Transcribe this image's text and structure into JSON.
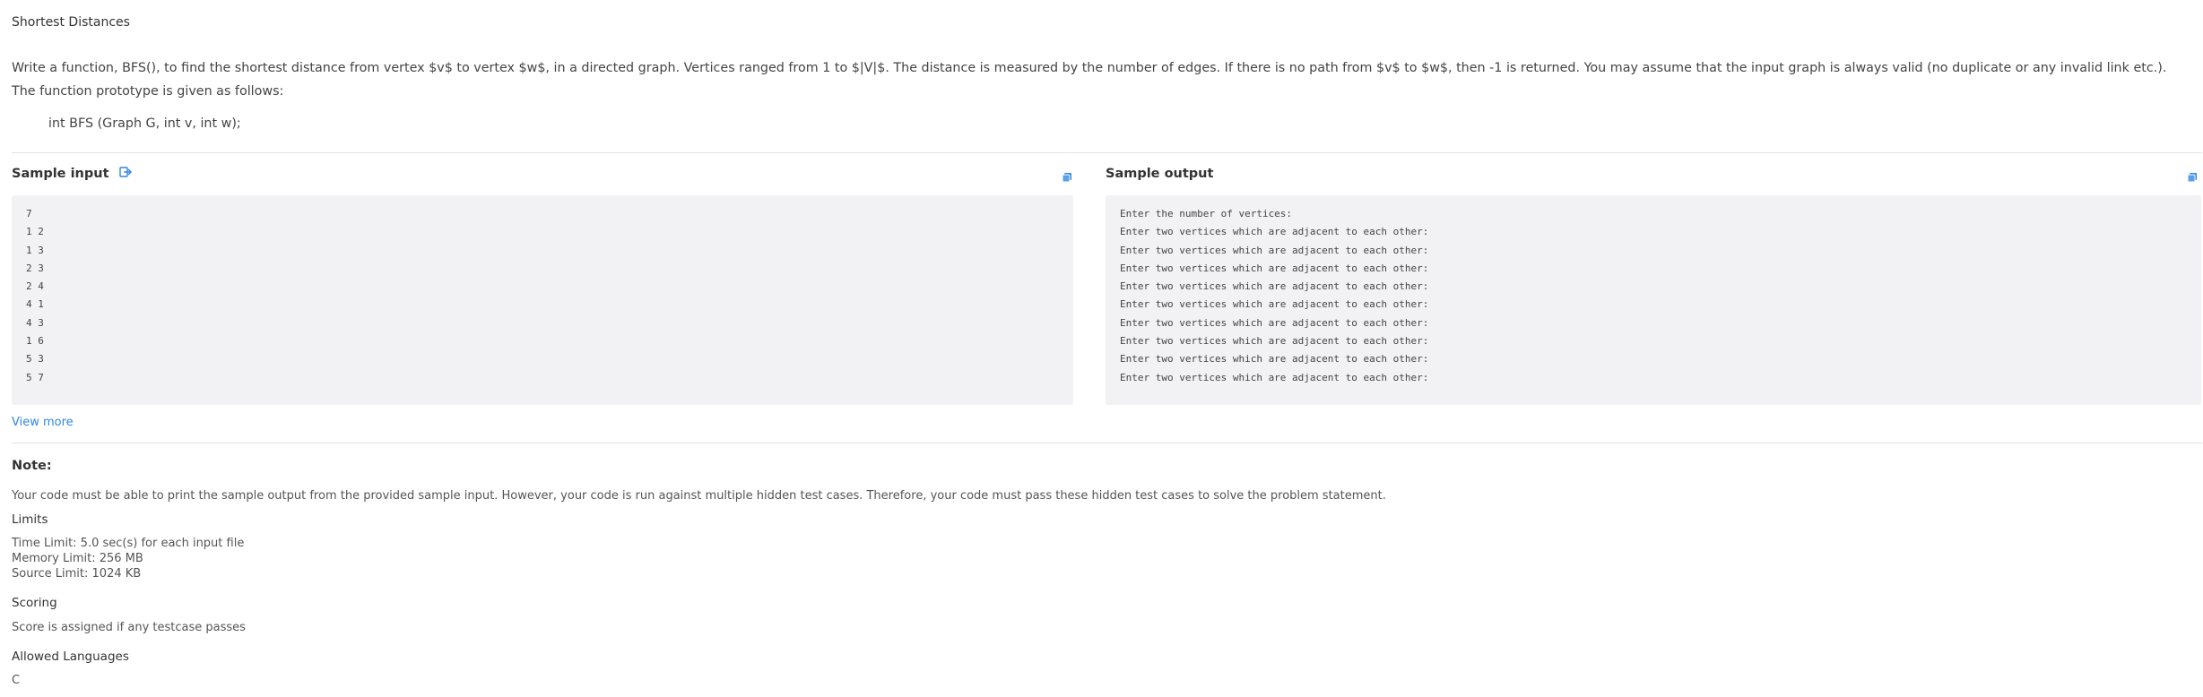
{
  "problem": {
    "title": "Shortest Distances",
    "description": "Write a function, BFS(), to find the shortest distance from vertex $v$ to vertex $w$, in a directed graph. Vertices ranged from 1 to $|V|$. The distance is measured by the number of edges. If there is no path from $v$ to $w$, then -1 is returned. You may assume that the input graph is always valid (no duplicate or any invalid link etc.).  The function prototype is given as follows:",
    "prototype": "int BFS (Graph G, int v, int w);"
  },
  "sample_input": {
    "label": "Sample input",
    "icon": "open-in-editor-icon",
    "lines": [
      "7",
      "1 2",
      "1 3",
      "2 3",
      "2 4",
      "4 1",
      "4 3",
      "1 6",
      "5 3",
      "5 7"
    ]
  },
  "sample_output": {
    "label": "Sample output",
    "lines": [
      "Enter the number of vertices:",
      "Enter two vertices which are adjacent to each other:",
      "Enter two vertices which are adjacent to each other:",
      "Enter two vertices which are adjacent to each other:",
      "Enter two vertices which are adjacent to each other:",
      "Enter two vertices which are adjacent to each other:",
      "Enter two vertices which are adjacent to each other:",
      "Enter two vertices which are adjacent to each other:",
      "Enter two vertices which are adjacent to each other:",
      "Enter two vertices which are adjacent to each other:"
    ]
  },
  "view_more": "View more",
  "note": {
    "heading": "Note:",
    "text": "Your code must be able to print the sample output from the provided sample input. However, your code is run against multiple hidden test cases. Therefore, your code must pass these hidden test cases to solve the problem statement."
  },
  "limits": {
    "heading": "Limits",
    "time": "Time Limit: 5.0 sec(s) for each input file",
    "memory": "Memory Limit: 256 MB",
    "source": "Source Limit: 1024 KB"
  },
  "scoring": {
    "heading": "Scoring",
    "text": "Score is assigned if any testcase passes"
  },
  "languages": {
    "heading": "Allowed Languages",
    "text": "C"
  },
  "colors": {
    "accent": "#2f86e0",
    "panel_bg": "#f2f2f5"
  }
}
